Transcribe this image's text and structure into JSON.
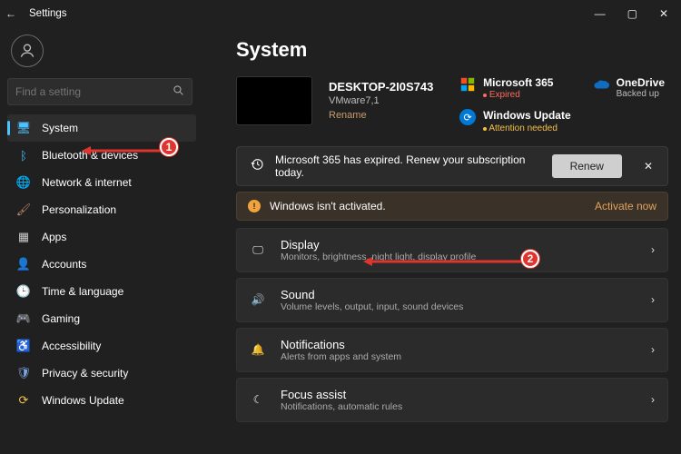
{
  "titlebar": {
    "back": "←",
    "title": "Settings"
  },
  "search": {
    "placeholder": "Find a setting"
  },
  "nav": {
    "items": [
      {
        "icon": "🖥",
        "label": "System",
        "active": true,
        "icon_color": "#4cc2ff"
      },
      {
        "icon": "ᛒ",
        "label": "Bluetooth & devices",
        "icon_color": "#4cc2ff"
      },
      {
        "icon": "🌐",
        "label": "Network & internet",
        "icon_color": "#4cc2ff"
      },
      {
        "icon": "🖌",
        "label": "Personalization",
        "icon_color": "#be8a6d"
      },
      {
        "icon": "▦",
        "label": "Apps",
        "icon_color": "#c9c9c9"
      },
      {
        "icon": "👤",
        "label": "Accounts",
        "icon_color": "#c9c9c9"
      },
      {
        "icon": "🕒",
        "label": "Time & language",
        "icon_color": "#7aa8e6"
      },
      {
        "icon": "🎮",
        "label": "Gaming",
        "icon_color": "#7bc97b"
      },
      {
        "icon": "♿",
        "label": "Accessibility",
        "icon_color": "#7aa8e6"
      },
      {
        "icon": "🛡",
        "label": "Privacy & security",
        "icon_color": "#7aa8e6"
      },
      {
        "icon": "⟳",
        "label": "Windows Update",
        "icon_color": "#f1c04c"
      }
    ]
  },
  "page": {
    "heading": "System",
    "device": {
      "name": "DESKTOP-2I0S743",
      "model": "VMware7,1",
      "rename": "Rename"
    },
    "status": {
      "m365": {
        "title": "Microsoft 365",
        "sub": "Expired",
        "sub_class": "red"
      },
      "onedrive": {
        "title": "OneDrive",
        "sub": "Backed up",
        "sub_class": "green"
      },
      "winupdate": {
        "title": "Windows Update",
        "sub": "Attention needed",
        "sub_class": "yellow"
      }
    },
    "banner1": {
      "text": "Microsoft 365 has expired. Renew your subscription today.",
      "button": "Renew"
    },
    "banner2": {
      "text": "Windows isn't activated.",
      "link": "Activate now"
    },
    "cards": [
      {
        "icon": "🖵",
        "title": "Display",
        "sub": "Monitors, brightness, night light, display profile"
      },
      {
        "icon": "🔊",
        "title": "Sound",
        "sub": "Volume levels, output, input, sound devices"
      },
      {
        "icon": "🔔",
        "title": "Notifications",
        "sub": "Alerts from apps and system"
      },
      {
        "icon": "☾",
        "title": "Focus assist",
        "sub": "Notifications, automatic rules"
      }
    ]
  },
  "annotations": {
    "1": "1",
    "2": "2"
  }
}
